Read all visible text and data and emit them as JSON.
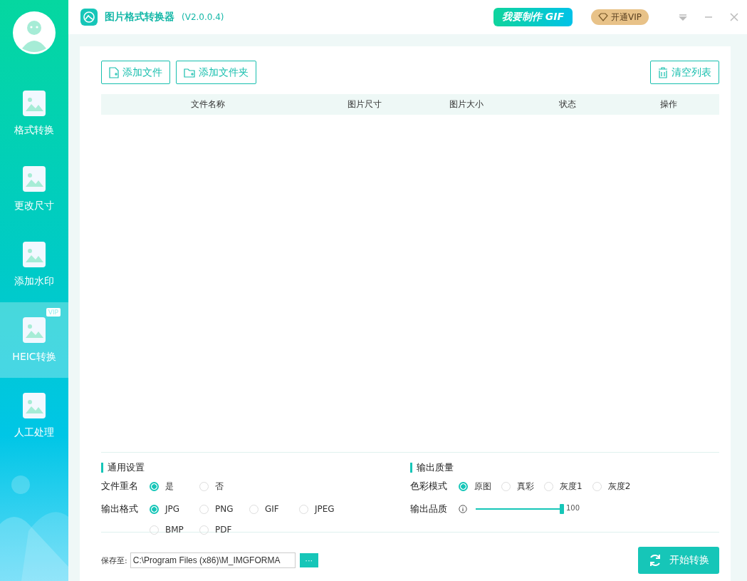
{
  "sidebar": {
    "items": [
      {
        "label": "格式转换",
        "selected": false
      },
      {
        "label": "更改尺寸",
        "selected": false
      },
      {
        "label": "添加水印",
        "selected": false
      },
      {
        "label": "HEIC转换",
        "selected": true,
        "badge": "VIP"
      },
      {
        "label": "人工处理",
        "selected": false
      }
    ]
  },
  "header": {
    "title": "图片格式转换器",
    "version": "(V2.0.0.4)",
    "gif_button": "我要制作 GIF",
    "vip_button": "开通VIP"
  },
  "toolbar": {
    "add_file": "添加文件",
    "add_folder": "添加文件夹",
    "clear": "清空列表"
  },
  "table": {
    "columns": [
      "文件名称",
      "图片尺寸",
      "图片大小",
      "状态",
      "操作"
    ]
  },
  "general": {
    "title": "通用设置",
    "rows": [
      {
        "label": "文件重名",
        "options": [
          {
            "label": "是",
            "selected": true
          },
          {
            "label": "否",
            "selected": false
          }
        ]
      },
      {
        "label": "输出格式",
        "options": [
          {
            "label": "JPG",
            "selected": true
          },
          {
            "label": "PNG",
            "selected": false
          },
          {
            "label": "GIF",
            "selected": false
          },
          {
            "label": "JPEG",
            "selected": false
          },
          {
            "label": "BMP",
            "selected": false
          },
          {
            "label": "PDF",
            "selected": false
          }
        ]
      }
    ]
  },
  "quality": {
    "title": "输出质量",
    "color_mode": {
      "label": "色彩模式",
      "options": [
        {
          "label": "原图",
          "selected": true
        },
        {
          "label": "真彩",
          "selected": false
        },
        {
          "label": "灰度1",
          "selected": false
        },
        {
          "label": "灰度2",
          "selected": false
        }
      ]
    },
    "slider": {
      "label": "输出品质",
      "level": 1,
      "reading": "100"
    }
  },
  "save": {
    "label": "保存至:",
    "path": "C:\\Program Files (x86)\\M_IMGFORMA",
    "browse": "···",
    "start": "开始转换"
  }
}
